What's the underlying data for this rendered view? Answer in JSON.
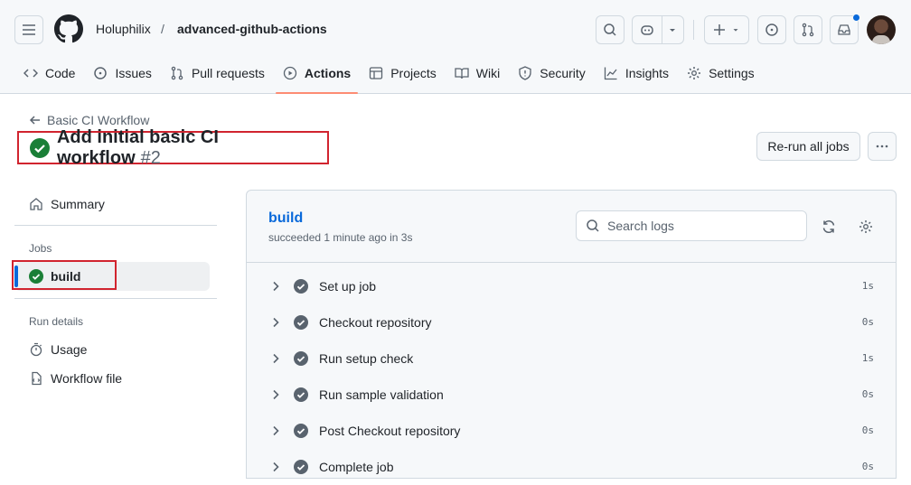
{
  "header": {
    "owner": "Holuphilix",
    "separator": "/",
    "repo": "advanced-github-actions"
  },
  "tabs": [
    {
      "label": "Code",
      "icon": "code-icon"
    },
    {
      "label": "Issues",
      "icon": "issue-icon"
    },
    {
      "label": "Pull requests",
      "icon": "pull-request-icon"
    },
    {
      "label": "Actions",
      "icon": "play-icon",
      "active": true
    },
    {
      "label": "Projects",
      "icon": "table-icon"
    },
    {
      "label": "Wiki",
      "icon": "book-icon"
    },
    {
      "label": "Security",
      "icon": "shield-icon"
    },
    {
      "label": "Insights",
      "icon": "graph-icon"
    },
    {
      "label": "Settings",
      "icon": "gear-icon"
    }
  ],
  "run": {
    "back_label": "Basic CI Workflow",
    "title": "Add initial basic CI workflow",
    "number": "#2",
    "rerun_label": "Re-run all jobs"
  },
  "sidebar": {
    "summary_label": "Summary",
    "jobs_heading": "Jobs",
    "job_label": "build",
    "run_details_heading": "Run details",
    "usage_label": "Usage",
    "workflow_file_label": "Workflow file"
  },
  "job": {
    "name": "build",
    "status": "succeeded 1 minute ago in 3s",
    "search_placeholder": "Search logs",
    "steps": [
      {
        "name": "Set up job",
        "duration": "1s"
      },
      {
        "name": "Checkout repository",
        "duration": "0s"
      },
      {
        "name": "Run setup check",
        "duration": "1s"
      },
      {
        "name": "Run sample validation",
        "duration": "0s"
      },
      {
        "name": "Post Checkout repository",
        "duration": "0s"
      },
      {
        "name": "Complete job",
        "duration": "0s"
      }
    ]
  },
  "colors": {
    "success": "#1a7f37",
    "link": "#0969da",
    "highlight_box": "#d1242f",
    "active_tab": "#fd8c73",
    "selected_bar": "#0969da"
  }
}
